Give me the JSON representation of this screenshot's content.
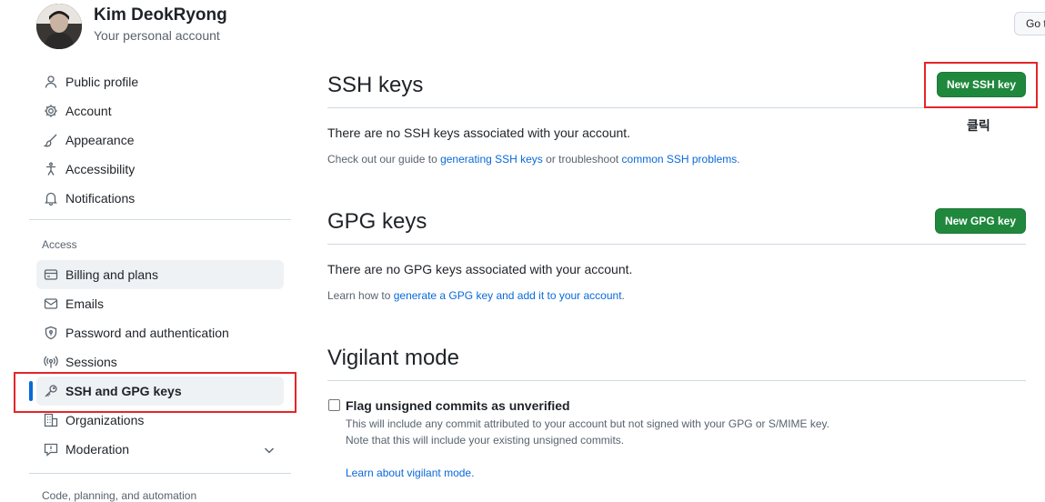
{
  "header": {
    "user_name": "Kim DeokRyong",
    "account_type": "Your personal account",
    "goto_button": "Go to"
  },
  "sidebar": {
    "items": [
      {
        "label": "Public profile",
        "icon": "person-icon"
      },
      {
        "label": "Account",
        "icon": "gear-icon"
      },
      {
        "label": "Appearance",
        "icon": "paintbrush-icon"
      },
      {
        "label": "Accessibility",
        "icon": "accessibility-icon"
      },
      {
        "label": "Notifications",
        "icon": "bell-icon"
      }
    ],
    "access_label": "Access",
    "access_items": [
      {
        "label": "Billing and plans",
        "icon": "credit-card-icon"
      },
      {
        "label": "Emails",
        "icon": "mail-icon"
      },
      {
        "label": "Password and authentication",
        "icon": "shield-lock-icon"
      },
      {
        "label": "Sessions",
        "icon": "broadcast-icon"
      },
      {
        "label": "SSH and GPG keys",
        "icon": "key-icon",
        "active": true
      },
      {
        "label": "Organizations",
        "icon": "organization-icon"
      },
      {
        "label": "Moderation",
        "icon": "report-icon"
      }
    ],
    "next_section_label": "Code, planning, and automation"
  },
  "ssh": {
    "title": "SSH keys",
    "new_button": "New SSH key",
    "empty_text": "There are no SSH keys associated with your account.",
    "guide_prefix": "Check out our guide to ",
    "guide_link": "generating SSH keys",
    "guide_middle": " or troubleshoot ",
    "troubleshoot_link": "common SSH problems",
    "guide_suffix": "."
  },
  "annotation": {
    "click_label": "클릭",
    "highlight_color": "#e5252a"
  },
  "gpg": {
    "title": "GPG keys",
    "new_button": "New GPG key",
    "empty_text": "There are no GPG keys associated with your account.",
    "learn_prefix": "Learn how to ",
    "learn_link": "generate a GPG key and add it to your account",
    "learn_suffix": "."
  },
  "vigilant": {
    "title": "Vigilant mode",
    "checkbox_label": "Flag unsigned commits as unverified",
    "checked": false,
    "desc_line1": "This will include any commit attributed to your account but not signed with your GPG or S/MIME key.",
    "desc_line2": "Note that this will include your existing unsigned commits.",
    "learn_link": "Learn about vigilant mode."
  },
  "colors": {
    "primary_button": "#1f883d",
    "link": "#0969da",
    "active_indicator": "#0969da"
  }
}
